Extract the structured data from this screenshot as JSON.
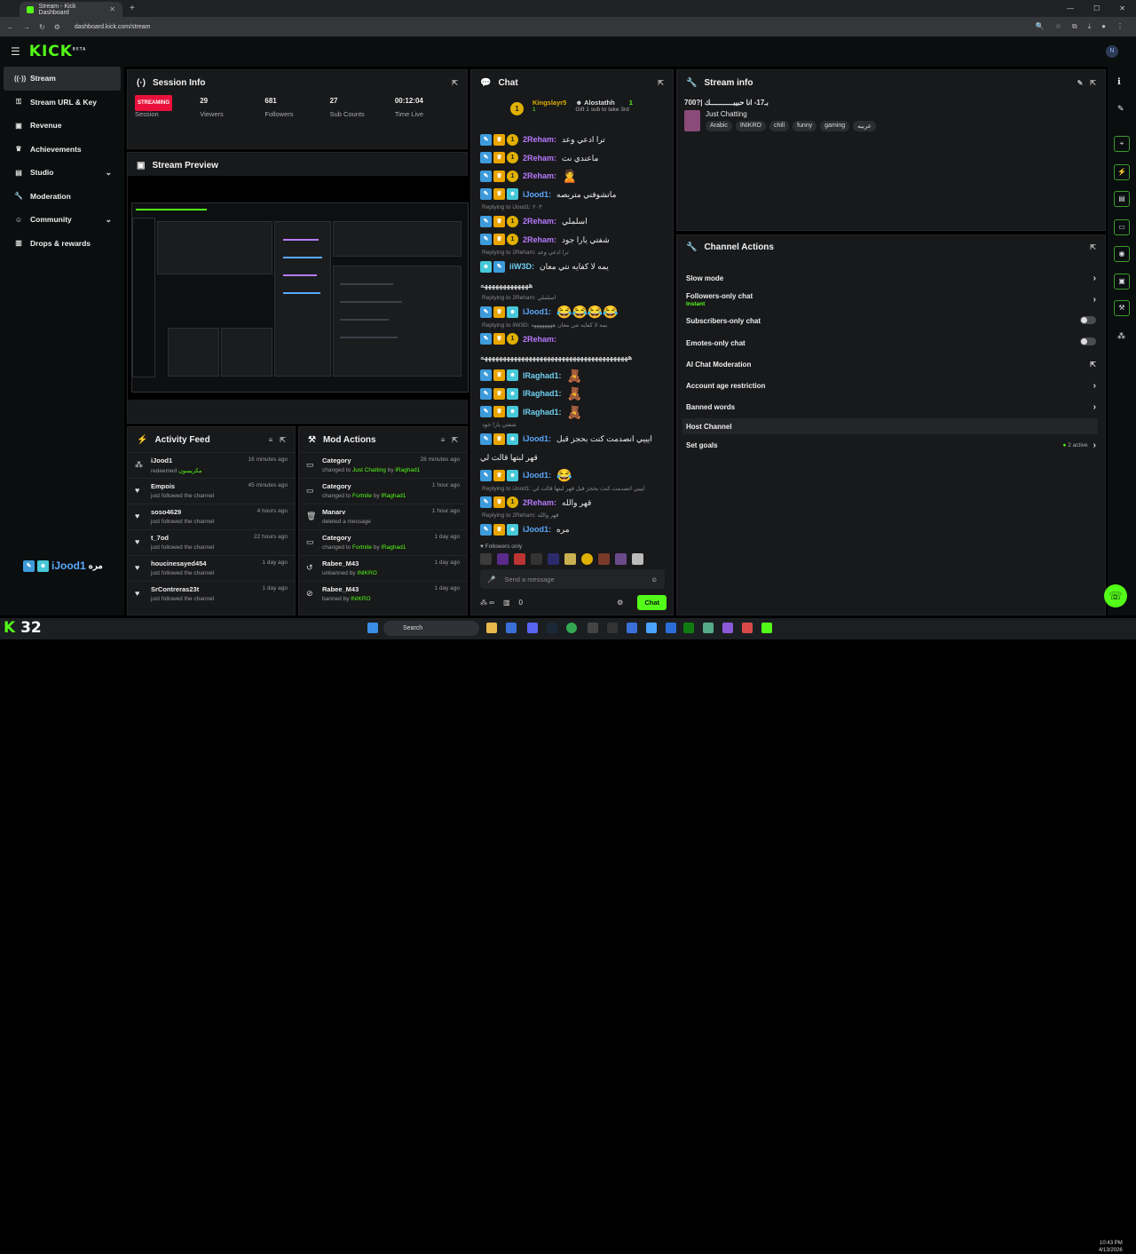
{
  "browser": {
    "tab_title": "Stream - Kick Dashboard",
    "url": "dashboard.kick.com/stream"
  },
  "brand": {
    "logo": "KICK",
    "beta": "BETA",
    "accent": "#53fc18"
  },
  "sidebar": {
    "items": [
      {
        "label": "Stream",
        "icon": "broadcast-icon",
        "active": true
      },
      {
        "label": "Stream URL & Key",
        "icon": "key-icon"
      },
      {
        "label": "Revenue",
        "icon": "money-icon"
      },
      {
        "label": "Achievements",
        "icon": "trophy-icon"
      },
      {
        "label": "Studio",
        "icon": "studio-icon",
        "expandable": true
      },
      {
        "label": "Moderation",
        "icon": "wrench-icon"
      },
      {
        "label": "Community",
        "icon": "community-icon",
        "expandable": true
      },
      {
        "label": "Drops & rewards",
        "icon": "gift-icon"
      }
    ]
  },
  "session": {
    "title": "Session Info",
    "status": "STREAMING",
    "status_label": "Session",
    "stats": [
      {
        "value": "29",
        "label": "Viewers"
      },
      {
        "value": "681",
        "label": "Followers"
      },
      {
        "value": "27",
        "label": "Sub Counts"
      },
      {
        "value": "00:12:04",
        "label": "Time Live"
      }
    ]
  },
  "preview": {
    "title": "Stream Preview"
  },
  "activity": {
    "title": "Activity Feed",
    "rows": [
      {
        "name": "iJood1",
        "detail": "redeemed",
        "reward": "مكريسون",
        "time": "16 minutes ago"
      },
      {
        "name": "Empois",
        "detail": "just followed the channel",
        "time": "45 minutes ago"
      },
      {
        "name": "soso4629",
        "detail": "just followed the channel",
        "time": "4 hours ago"
      },
      {
        "name": "t_7od",
        "detail": "just followed the channel",
        "time": "22 hours ago"
      },
      {
        "name": "houcinesayed454",
        "detail": "just followed the channel",
        "time": "1 day ago"
      },
      {
        "name": "SrContreras23t",
        "detail": "just followed the channel",
        "time": "1 day ago"
      }
    ]
  },
  "mod": {
    "title": "Mod Actions",
    "rows": [
      {
        "name": "Category",
        "pre": "changed to ",
        "hl": "Just Chatting",
        "mid": " by ",
        "hl2": "lRaghad1",
        "time": "28 minutes ago"
      },
      {
        "name": "Category",
        "pre": "changed to ",
        "hl": "Fortnite",
        "mid": " by ",
        "hl2": "lRaghad1",
        "time": "1 hour ago"
      },
      {
        "name": "Manarv",
        "pre": "deleted a message",
        "hl": "",
        "mid": "",
        "hl2": "",
        "time": "1 hour ago"
      },
      {
        "name": "Category",
        "pre": "changed to ",
        "hl": "Fortnite",
        "mid": " by ",
        "hl2": "lRaghad1",
        "time": "1 day ago"
      },
      {
        "name": "Rabee_M43",
        "pre": "unbanned by ",
        "hl": "INIKRO",
        "mid": "",
        "hl2": "",
        "time": "1 day ago"
      },
      {
        "name": "Rabee_M43",
        "pre": "banned by ",
        "hl": "INIKRO",
        "mid": "",
        "hl2": "",
        "time": "1 day ago"
      }
    ]
  },
  "chat": {
    "title": "Chat",
    "top_gifters": [
      {
        "name": "Kingslayr5",
        "count": "1"
      },
      {
        "name": "Alostathh",
        "count": "1",
        "note": "Gift 1 sub to take 3rd"
      }
    ],
    "messages": [
      {
        "user": "2Reham:",
        "cls": "user-p",
        "text": "ترا ادعي وعد",
        "badges": [
          "mod",
          "crown",
          "lvl"
        ]
      },
      {
        "user": "2Reham:",
        "cls": "user-p",
        "text": "ماعندي نت",
        "badges": [
          "mod",
          "crown",
          "lvl"
        ]
      },
      {
        "user": "2Reham:",
        "cls": "user-p",
        "text": "🙎",
        "badges": [
          "mod",
          "crown",
          "lvl"
        ]
      },
      {
        "user": "iJood1:",
        "cls": "user-b",
        "text": "ماتشوفني متربصه",
        "badges": [
          "mod",
          "crown",
          "sub"
        ]
      },
      {
        "reply": "Replying to iJood1: ٢٠٣"
      },
      {
        "user": "2Reham:",
        "cls": "user-p",
        "text": "اسلملي",
        "badges": [
          "mod",
          "crown",
          "lvl"
        ]
      },
      {
        "user": "2Reham:",
        "cls": "user-p",
        "text": "شفتي يارا جود",
        "badges": [
          "mod",
          "crown",
          "lvl"
        ]
      },
      {
        "reply": "Replying to 2Reham: ترا ادعي وعد"
      },
      {
        "user": "iiW3D:",
        "cls": "user-c",
        "text": "يمه لا كفايه نتي معان",
        "badges": [
          "sub",
          "mod"
        ]
      },
      {
        "cont": "هههههههههههههه"
      },
      {
        "reply": "Replying to 2Reham: اسلملي"
      },
      {
        "user": "iJood1:",
        "cls": "user-b",
        "text": "😂😂😂😂",
        "badges": [
          "mod",
          "crown",
          "sub"
        ]
      },
      {
        "reply": "Replying to iiW3D: يمه لا كفايه نتي معان ههههههههه"
      },
      {
        "user": "2Reham:",
        "cls": "user-p",
        "text": "",
        "badges": [
          "mod",
          "crown",
          "lvl"
        ]
      },
      {
        "cont": "ههههههههههههههههههههههههههههههههههههههههه"
      },
      {
        "user": "lRaghad1:",
        "cls": "user-c",
        "text": "🧸",
        "badges": [
          "mod",
          "crown",
          "sub"
        ]
      },
      {
        "user": "lRaghad1:",
        "cls": "user-c",
        "text": "🧸",
        "badges": [
          "mod",
          "crown",
          "sub"
        ]
      },
      {
        "user": "lRaghad1:",
        "cls": "user-c",
        "text": "🧸",
        "badges": [
          "mod",
          "crown",
          "sub"
        ]
      },
      {
        "reply": "شفتي يارا جود"
      },
      {
        "user": "iJood1:",
        "cls": "user-b",
        "text": "ايييي انصدمت كنت بحجز قبل",
        "badges": [
          "mod",
          "crown",
          "sub"
        ]
      },
      {
        "cont": "قهر لبتها قالت لي"
      },
      {
        "user": "iJood1:",
        "cls": "user-b",
        "text": "😂",
        "badges": [
          "mod",
          "crown",
          "sub"
        ]
      },
      {
        "reply": "Replying to iJood1: ايييي انصدمت كنت بحجز قبل قهر لبتها قالت لي"
      },
      {
        "user": "2Reham:",
        "cls": "user-p",
        "text": "قهر والله",
        "badges": [
          "mod",
          "crown",
          "lvl"
        ]
      },
      {
        "reply": "Replying to 2Reham: قهر والله"
      },
      {
        "user": "iJood1:",
        "cls": "user-b",
        "text": "مره",
        "badges": [
          "mod",
          "crown",
          "sub"
        ]
      }
    ],
    "followers_only": "Followers only",
    "input_placeholder": "Send a message",
    "foot_count": "0",
    "send_label": "Chat"
  },
  "stream_info": {
    "title": "Stream info",
    "stream_title": "700?| بـ17- انا حبيبـــــــــــك",
    "category": "Just Chatting",
    "tags": [
      "Arabic",
      "INIKRO",
      "chill",
      "funny",
      "gaming",
      "عربيه"
    ]
  },
  "channel_actions": {
    "title": "Channel Actions",
    "rows": [
      {
        "label": "Slow mode",
        "kind": "chevron"
      },
      {
        "label": "Followers-only chat",
        "sub": "Instant",
        "kind": "chevron"
      },
      {
        "label": "Subscribers-only chat",
        "kind": "toggle"
      },
      {
        "label": "Emotes-only chat",
        "kind": "toggle"
      },
      {
        "label": "AI Chat Moderation",
        "kind": "external"
      },
      {
        "label": "Account age restriction",
        "kind": "chevron"
      },
      {
        "label": "Banned words",
        "kind": "chevron"
      },
      {
        "label": "Host Channel",
        "kind": "none"
      },
      {
        "label": "Set goals",
        "kind": "goals",
        "note": "2 active"
      }
    ]
  },
  "overlay": {
    "user": "iJood1",
    "suffix": "مره"
  },
  "taskbar": {
    "search": "Search",
    "time": "10:43 PM",
    "date": "4/13/2026",
    "brand_left": "K 32"
  }
}
